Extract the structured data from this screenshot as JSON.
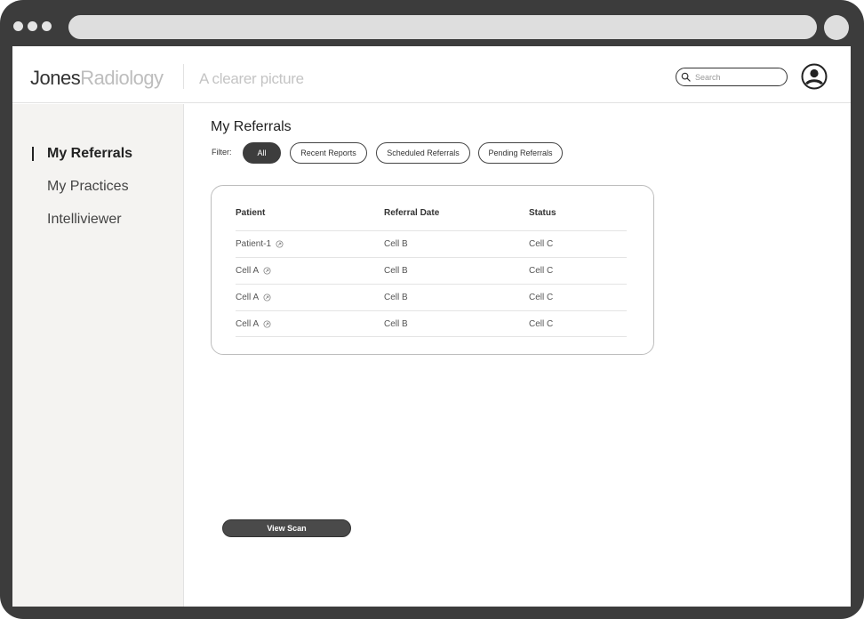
{
  "header": {
    "logo_primary": "Jones",
    "logo_secondary": "Radiology",
    "tagline": "A clearer picture",
    "search_placeholder": "Search"
  },
  "sidebar": {
    "items": [
      {
        "label": "My Referrals",
        "active": true
      },
      {
        "label": "My Practices",
        "active": false
      },
      {
        "label": "Intelliviewer",
        "active": false
      }
    ]
  },
  "main": {
    "title": "My Referrals",
    "filter_label": "Filter:",
    "filters": [
      {
        "label": "All",
        "selected": true
      },
      {
        "label": "Recent Reports",
        "selected": false
      },
      {
        "label": "Scheduled Referrals",
        "selected": false
      },
      {
        "label": "Pending Referrals",
        "selected": false
      }
    ],
    "table": {
      "columns": [
        "Patient",
        "Referral Date",
        "Status"
      ],
      "rows": [
        [
          "Patient-1",
          "Cell B",
          "Cell C"
        ],
        [
          "Cell A",
          "Cell B",
          "Cell C"
        ],
        [
          "Cell A",
          "Cell B",
          "Cell C"
        ],
        [
          "Cell A",
          "Cell B",
          "Cell C"
        ]
      ]
    },
    "view_scan_label": "View Scan"
  },
  "icons": {
    "search": "search-icon",
    "avatar": "user-avatar-icon",
    "row_link": "external-link-icon"
  },
  "colors": {
    "frame": "#3c3c3c",
    "sidebar_bg": "#f4f3f1",
    "selected_chip": "#3d3d3d",
    "button": "#4a4a4a"
  }
}
